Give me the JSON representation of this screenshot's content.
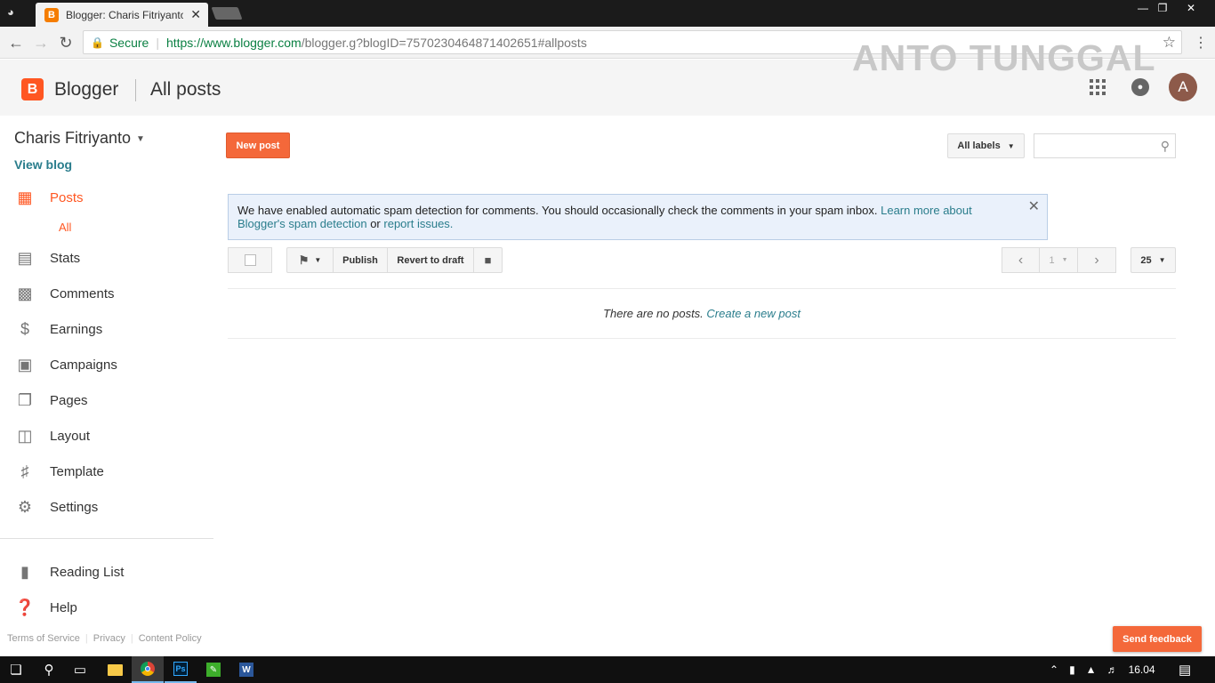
{
  "browser": {
    "tab_title": "Blogger: Charis Fitriyanto",
    "secure_label": "Secure",
    "url_host": "https://www.blogger.com",
    "url_path": "/blogger.g?blogID=7570230464871402651#allposts"
  },
  "watermark": "ANTO TUNGGAL",
  "appbar": {
    "brand": "Blogger",
    "page_title": "All posts",
    "avatar_letter": "A"
  },
  "sidebar": {
    "blog_name": "Charis Fitriyanto",
    "view_blog": "View blog",
    "posts": "Posts",
    "posts_sub": "All",
    "items": [
      {
        "label": "Stats",
        "icon": "stats-icon"
      },
      {
        "label": "Comments",
        "icon": "comment-icon"
      },
      {
        "label": "Earnings",
        "icon": "dollar-icon"
      },
      {
        "label": "Campaigns",
        "icon": "ad-icon"
      },
      {
        "label": "Pages",
        "icon": "pages-icon"
      },
      {
        "label": "Layout",
        "icon": "layout-icon"
      },
      {
        "label": "Template",
        "icon": "paint-roller-icon"
      },
      {
        "label": "Settings",
        "icon": "gear-icon"
      }
    ],
    "reading_list": "Reading List",
    "help": "Help",
    "footer": {
      "terms": "Terms of Service",
      "privacy": "Privacy",
      "content_policy": "Content Policy"
    }
  },
  "main": {
    "new_post": "New post",
    "labels_filter": "All labels",
    "notice": {
      "text": "We have enabled automatic spam detection for comments. You should occasionally check the comments in your spam inbox.",
      "link1": "Learn more about Blogger's spam detection",
      "middle": "or",
      "link2": "report issues."
    },
    "toolbar": {
      "publish": "Publish",
      "revert": "Revert to draft"
    },
    "pagination": {
      "page": "1",
      "per_page": "25"
    },
    "empty_text": "There are no posts.",
    "empty_link": "Create a new post"
  },
  "send_feedback": "Send feedback",
  "taskbar": {
    "time": "16.04"
  },
  "colors": {
    "accent": "#ff5722",
    "link": "#2a7d8c",
    "notice_bg": "#eaf1fb"
  }
}
